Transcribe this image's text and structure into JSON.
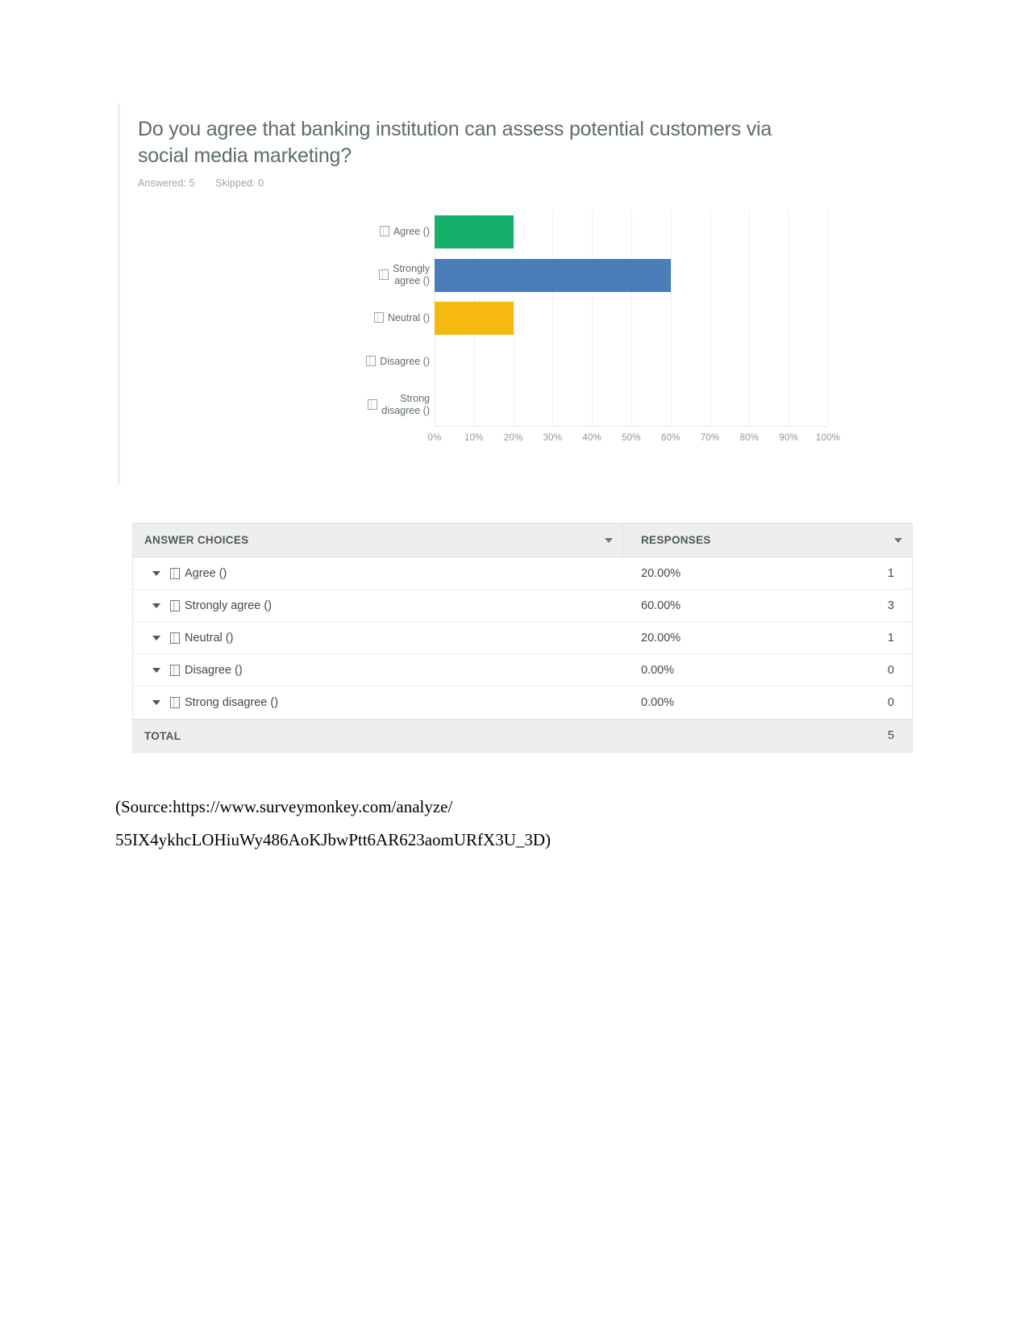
{
  "chart_card": {
    "question": "Do you agree that banking institution can assess potential customers via social media marketing?",
    "answered_label": "Answered: 5",
    "skipped_label": "Skipped: 0"
  },
  "chart_data": {
    "type": "bar",
    "orientation": "horizontal",
    "title": "Do you agree that banking institution can assess potential customers via social media marketing?",
    "xlabel": "",
    "ylabel": "",
    "xlim": [
      0,
      100
    ],
    "grid": true,
    "legend_position": "none",
    "categories": [
      "Agree ()",
      "Strongly agree ()",
      "Neutral ()",
      "Disagree ()",
      "Strong disagree ()"
    ],
    "values": [
      20.0,
      60.0,
      20.0,
      0.0,
      0.0
    ],
    "counts": [
      1,
      3,
      1,
      0,
      0
    ],
    "colors": [
      "#16b06b",
      "#4a7ebb",
      "#f5b910",
      "#e06666",
      "#7b5ea7"
    ],
    "xticks": [
      "0%",
      "10%",
      "20%",
      "30%",
      "40%",
      "50%",
      "60%",
      "70%",
      "80%",
      "90%",
      "100%"
    ],
    "bar_label_lines": [
      [
        "Agree ()"
      ],
      [
        "Strongly",
        "agree ()"
      ],
      [
        "Neutral ()"
      ],
      [
        "Disagree ()"
      ],
      [
        "Strong",
        "disagree ()"
      ]
    ]
  },
  "table": {
    "columns": {
      "choices": "ANSWER CHOICES",
      "responses": "RESPONSES"
    },
    "rows": [
      {
        "label": "Agree ()",
        "percent": "20.00%",
        "count": "1"
      },
      {
        "label": "Strongly agree ()",
        "percent": "60.00%",
        "count": "3"
      },
      {
        "label": "Neutral ()",
        "percent": "20.00%",
        "count": "1"
      },
      {
        "label": "Disagree ()",
        "percent": "0.00%",
        "count": "0"
      },
      {
        "label": "Strong disagree ()",
        "percent": "0.00%",
        "count": "0"
      }
    ],
    "total": {
      "label": "TOTAL",
      "count": "5"
    }
  },
  "source": {
    "line1": "(Source:https://www.surveymonkey.com/analyze/",
    "line2": "55IX4ykhcLOHiuWy486AoKJbwPtt6AR623aomURfX3U_3D)"
  }
}
